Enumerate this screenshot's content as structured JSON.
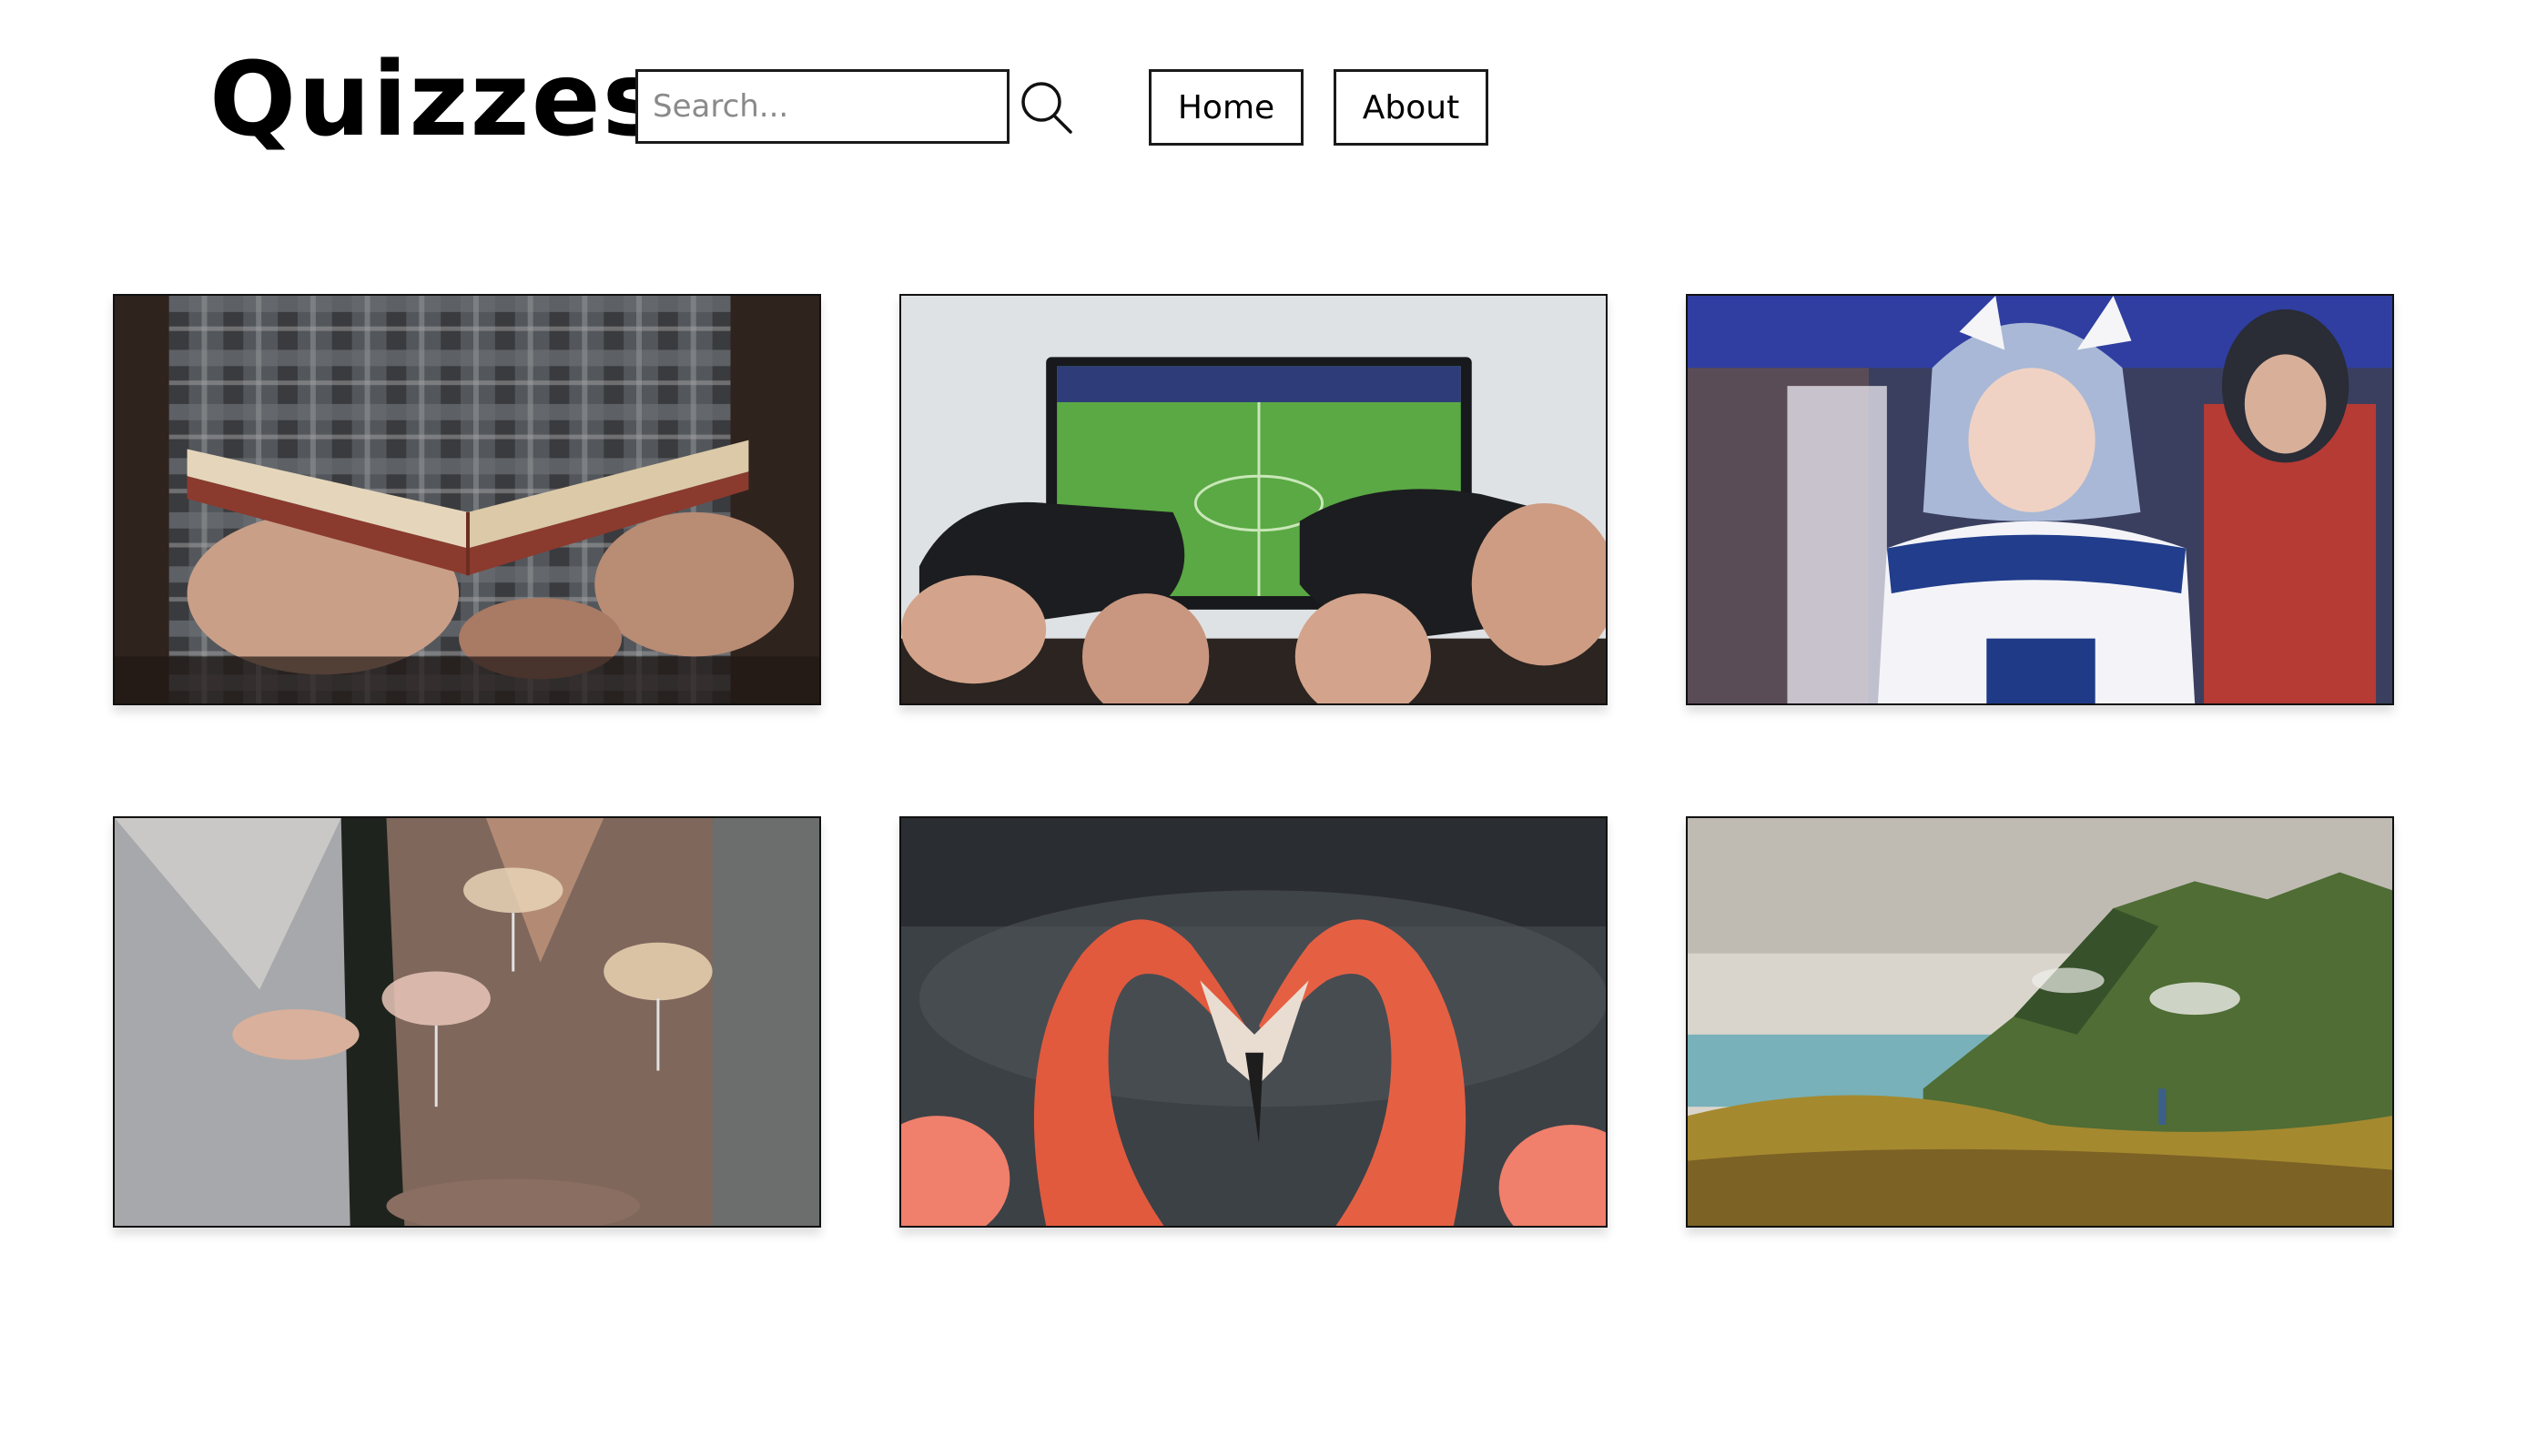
{
  "header": {
    "title": "Quizzes",
    "search": {
      "placeholder": "Search...",
      "value": "",
      "icon": "search-icon"
    },
    "nav": [
      {
        "label": "Home"
      },
      {
        "label": "About"
      }
    ]
  },
  "quiz_cards": [
    {
      "image": "person-reading-old-book"
    },
    {
      "image": "hands-holding-game-controllers-football-tv"
    },
    {
      "image": "cosplayer-white-cat-ears-blue-costume"
    },
    {
      "image": "people-toasting-champagne-coupes"
    },
    {
      "image": "two-flamingos-forming-heart"
    },
    {
      "image": "green-mountain-valley-landscape"
    }
  ],
  "colors": {
    "background": "#ffffff",
    "border": "#1a1a1a",
    "placeholder": "#8a8a8a"
  }
}
